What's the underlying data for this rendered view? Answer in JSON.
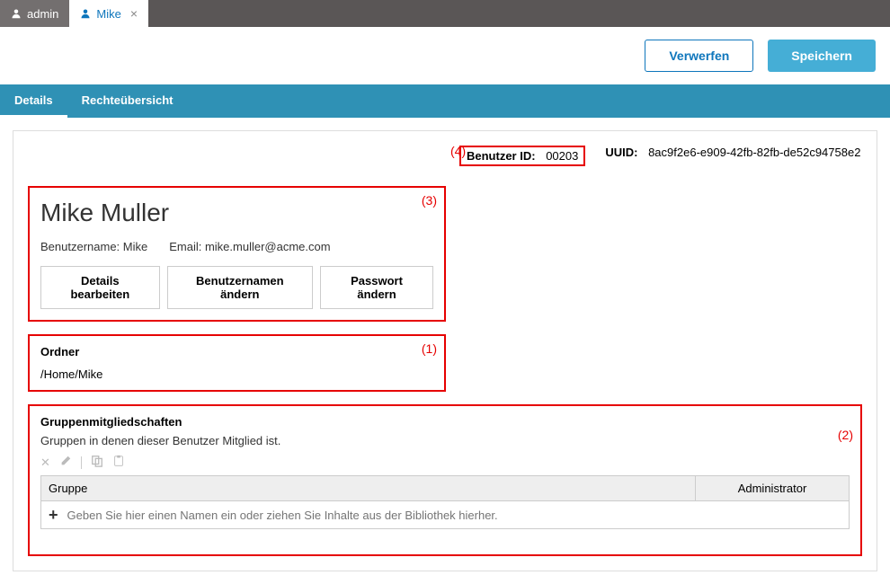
{
  "tabs": {
    "inactive": {
      "label": "admin"
    },
    "active": {
      "label": "Mike"
    }
  },
  "actions": {
    "discard": "Verwerfen",
    "save": "Speichern"
  },
  "nav": {
    "details": "Details",
    "rights": "Rechteübersicht"
  },
  "idrow": {
    "userid_label": "Benutzer ID:",
    "userid_value": "00203",
    "uuid_label": "UUID:",
    "uuid_value": "8ac9f2e6-e909-42fb-82fb-de52c94758e2"
  },
  "user": {
    "name": "Mike Muller",
    "username_label": "Benutzername: Mike",
    "email_label": "Email: mike.muller@acme.com",
    "btn_edit": "Details bearbeiten",
    "btn_username": "Benutzernamen ändern",
    "btn_password": "Passwort ändern"
  },
  "folder": {
    "title": "Ordner",
    "path": "/Home/Mike"
  },
  "groups": {
    "title": "Gruppenmitgliedschaften",
    "subtitle": "Gruppen in denen dieser Benutzer Mitglied ist.",
    "col_group": "Gruppe",
    "col_admin": "Administrator",
    "placeholder": "Geben Sie hier einen Namen ein oder ziehen Sie Inhalte aus der Bibliothek hierher."
  },
  "annotations": {
    "a1": "(1)",
    "a2": "(2)",
    "a3": "(3)",
    "a4": "(4)"
  }
}
